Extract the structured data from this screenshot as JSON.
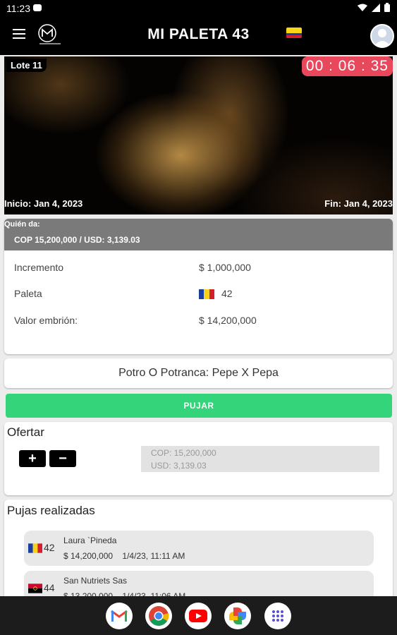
{
  "status_bar": {
    "time": "11:23"
  },
  "header": {
    "title": "MI PALETA 43"
  },
  "video": {
    "lot": "Lote 11",
    "timer": "00 : 06 : 35",
    "start": "Inicio: Jan 4, 2023",
    "end": "Fin: Jan 4, 2023"
  },
  "current_bid": {
    "label": "Quién da:",
    "value": "COP 15,200,000 / USD: 3,139.03",
    "increment_label": "Incremento",
    "increment_value": "$ 1,000,000",
    "paddle_label": "Paleta",
    "paddle_value": "42",
    "embryo_label": "Valor embrión:",
    "embryo_value": "$ 14,200,000"
  },
  "lot_name": "Potro O Potranca: Pepe X Pepa",
  "bid_button": "PUJAR",
  "offer": {
    "title": "Ofertar",
    "plus": "+",
    "minus": "−",
    "cop": "COP: 15,200,000",
    "usd": "USD: 3,139.03"
  },
  "bids": {
    "title": "Pujas realizadas",
    "items": [
      {
        "paddle": "42",
        "name": "Laura `Pineda",
        "amount": "$ 14,200,000",
        "date": "1/4/23, 11:11 AM"
      },
      {
        "paddle": "44",
        "name": "San Nutriets Sas",
        "amount": "$ 13,200,000",
        "date": "1/4/23, 11:06 AM"
      }
    ]
  },
  "colors": {
    "header_bg": "#000000",
    "timer_bg": "#e8475c",
    "bid_button_bg": "#33d47a",
    "current_bid_bg": "#7a7a7a"
  },
  "dock_apps": [
    "gmail-icon",
    "chrome-icon",
    "youtube-icon",
    "photos-icon",
    "app-drawer-icon"
  ]
}
